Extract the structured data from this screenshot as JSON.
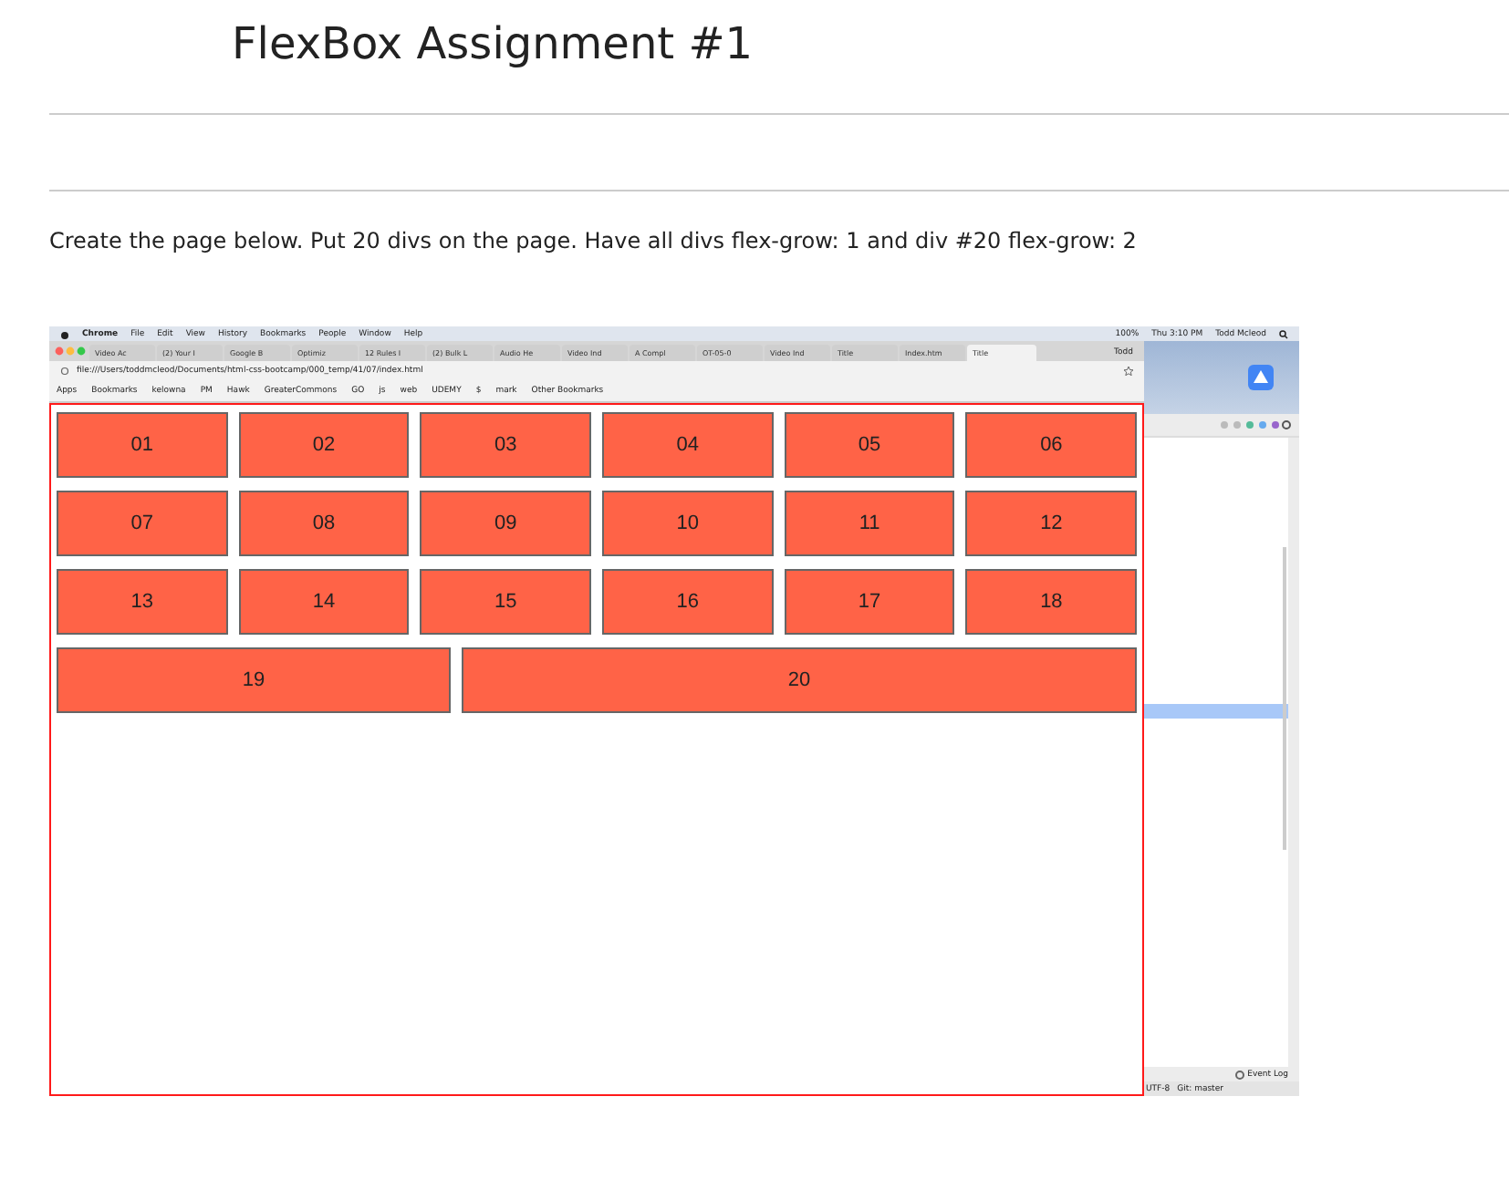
{
  "page": {
    "title": "FlexBox Assignment #1",
    "instruction": "Create the page below. Put 20 divs on the page. Have all divs flex-grow: 1 and div #20 flex-grow: 2"
  },
  "screenshot": {
    "menu_bar": {
      "app": "Chrome",
      "items": [
        "File",
        "Edit",
        "View",
        "History",
        "Bookmarks",
        "People",
        "Window",
        "Help"
      ],
      "status": [
        "100%",
        "Thu 3:10 PM",
        "Todd Mcleod"
      ]
    },
    "tabs": [
      {
        "label": "Video Ac",
        "selected": false
      },
      {
        "label": "(2) Your I",
        "selected": false
      },
      {
        "label": "Google B",
        "selected": false
      },
      {
        "label": "Optimiz",
        "selected": false
      },
      {
        "label": "12 Rules I",
        "selected": false
      },
      {
        "label": "(2) Bulk L",
        "selected": false
      },
      {
        "label": "Audio He",
        "selected": false
      },
      {
        "label": "Video Ind",
        "selected": false
      },
      {
        "label": "A Compl",
        "selected": false
      },
      {
        "label": "OT-05-0",
        "selected": false
      },
      {
        "label": "Video Ind",
        "selected": false
      },
      {
        "label": "Title",
        "selected": false
      },
      {
        "label": "Index.htm",
        "selected": false
      },
      {
        "label": "Title",
        "selected": true
      }
    ],
    "profile": "Todd",
    "address": "file:///Users/toddmcleod/Documents/html-css-bootcamp/000_temp/41/07/index.html",
    "bookmarks": [
      "Apps",
      "Bookmarks",
      "kelowna",
      "PM",
      "Hawk",
      "GreaterCommons",
      "GO",
      "js",
      "web",
      "UDEMY",
      "$",
      "mark",
      "Other Bookmarks"
    ],
    "boxes": [
      {
        "label": "01",
        "wide": false
      },
      {
        "label": "02",
        "wide": false
      },
      {
        "label": "03",
        "wide": false
      },
      {
        "label": "04",
        "wide": false
      },
      {
        "label": "05",
        "wide": false
      },
      {
        "label": "06",
        "wide": false
      },
      {
        "label": "07",
        "wide": false
      },
      {
        "label": "08",
        "wide": false
      },
      {
        "label": "09",
        "wide": false
      },
      {
        "label": "10",
        "wide": false
      },
      {
        "label": "11",
        "wide": false
      },
      {
        "label": "12",
        "wide": false
      },
      {
        "label": "13",
        "wide": false
      },
      {
        "label": "14",
        "wide": false
      },
      {
        "label": "15",
        "wide": false
      },
      {
        "label": "16",
        "wide": false
      },
      {
        "label": "17",
        "wide": false
      },
      {
        "label": "18",
        "wide": false
      },
      {
        "label": "19",
        "wide": false
      },
      {
        "label": "20",
        "wide": true
      }
    ],
    "ide": {
      "event_log": "Event Log",
      "status": [
        "UTF-8",
        "Git: master"
      ]
    }
  }
}
